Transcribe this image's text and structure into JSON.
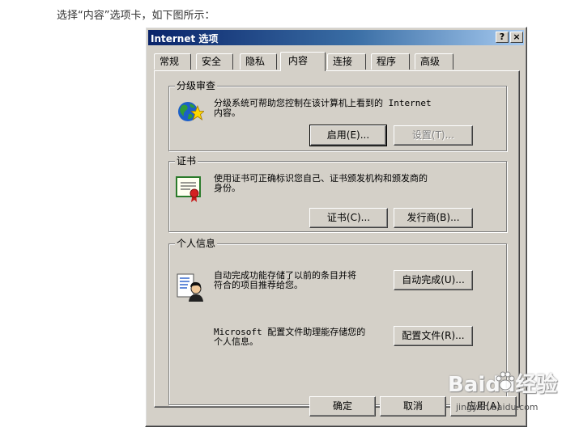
{
  "caption": "选择“内容”选项卡，如下图所示：",
  "dialog": {
    "title": "Internet 选项",
    "help_button": "?",
    "close_button": "×"
  },
  "tabs": [
    "常规",
    "安全",
    "隐私",
    "内容",
    "连接",
    "程序",
    "高级"
  ],
  "active_tab": "内容",
  "content_advisor": {
    "label": "分级审查",
    "description_line1": "分级系统可帮助您控制在该计算机上看到的 Internet",
    "description_line2": "内容。",
    "enable_button": "启用(E)...",
    "settings_button": "设置(T)..."
  },
  "certificates": {
    "label": "证书",
    "description_line1": "使用证书可正确标识您自己、证书颁发机构和颁发商的",
    "description_line2": "身份。",
    "certificates_button": "证书(C)...",
    "publishers_button": "发行商(B)..."
  },
  "personal_info": {
    "label": "个人信息",
    "autocomplete_line1": "自动完成功能存储了以前的条目并将",
    "autocomplete_line2": "符合的项目推荐给您。",
    "autocomplete_button": "自动完成(U)...",
    "profile_line1": "Microsoft 配置文件助理能存储您的",
    "profile_line2": "个人信息。",
    "profile_button": "配置文件(R)..."
  },
  "footer": {
    "ok_button": "确定",
    "cancel_button": "取消",
    "apply_button": "应用(A)"
  },
  "watermark": {
    "brand": "Baidu经验",
    "url": "jingyan.baidu.com"
  }
}
